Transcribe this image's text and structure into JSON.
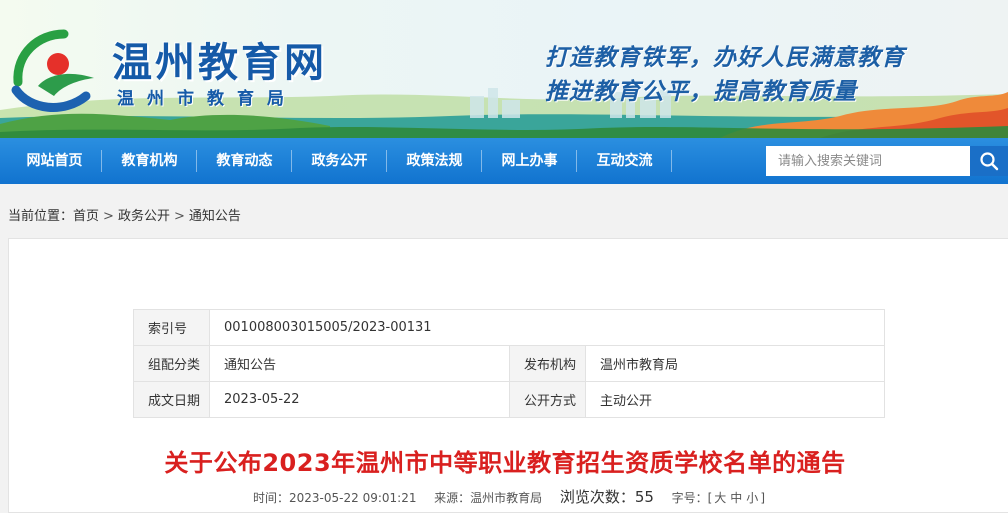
{
  "site": {
    "title": "温州教育网",
    "subtitle": "温州市教育局",
    "slogan_line1": "打造教育铁军，办好人民满意教育",
    "slogan_line2": "推进教育公平，提高教育质量"
  },
  "nav": {
    "items": [
      "网站首页",
      "教育机构",
      "教育动态",
      "政务公开",
      "政策法规",
      "网上办事",
      "互动交流"
    ],
    "search_placeholder": "请输入搜索关键词"
  },
  "breadcrumb": {
    "label": "当前位置：",
    "items": [
      "首页",
      "政务公开",
      "通知公告"
    ],
    "separator": ">"
  },
  "meta": {
    "index_label": "索引号",
    "index_value": "001008003015005/2023-00131",
    "category_label": "组配分类",
    "category_value": "通知公告",
    "publisher_label": "发布机构",
    "publisher_value": "温州市教育局",
    "date_label": "成文日期",
    "date_value": "2023-05-22",
    "open_label": "公开方式",
    "open_value": "主动公开"
  },
  "article": {
    "title": "关于公布2023年温州市中等职业教育招生资质学校名单的通告",
    "time_label": "时间：",
    "time_value": "2023-05-22 09:01:21",
    "source_label": "来源：",
    "source_value": "温州市教育局",
    "views_label": "浏览次数：",
    "views_value": "55",
    "font_label": "字号：[",
    "font_large": "大",
    "font_medium": "中",
    "font_small": "小",
    "font_end": "]"
  },
  "colors": {
    "nav_blue": "#1a7fd6",
    "title_red": "#d9201f",
    "brand_blue": "#155aa8"
  }
}
